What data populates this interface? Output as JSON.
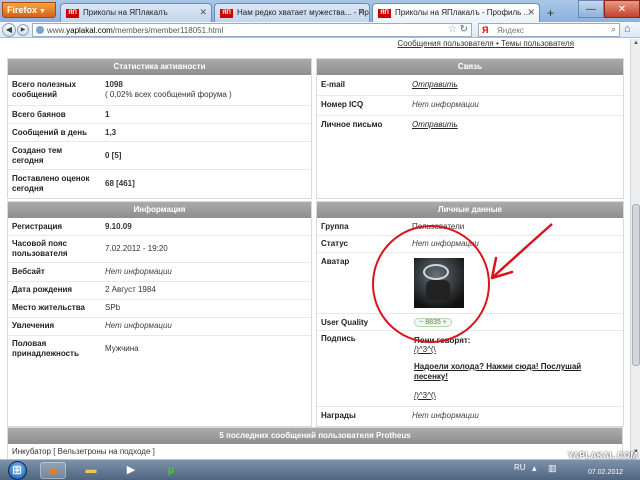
{
  "browser": {
    "menu_label": "Firefox",
    "tabs": [
      {
        "label": "Приколы на ЯПлакалъ",
        "active": false
      },
      {
        "label": "Нам редко хватает мужества... - Пр...",
        "active": false
      },
      {
        "label": "Приколы на ЯПлакалъ - Профиль ...",
        "active": true
      }
    ],
    "url_prefix": "www.",
    "url_domain": "yaplakal.com",
    "url_path": "/members/member118051.html",
    "search_placeholder": "Яндекс",
    "icons": [
      "back-icon",
      "forward-icon",
      "star-icon",
      "reload-icon",
      "search-icon",
      "home-icon"
    ]
  },
  "page": {
    "top_links": "Сообщения пользователя • Темы пользователя",
    "activity": {
      "title": "Статистика активности",
      "rows": [
        {
          "label": "Всего полезных сообщений",
          "value": "1098",
          "sub": "( 0,02% всех сообщений форума )"
        },
        {
          "label": "Всего баянов",
          "value": "1"
        },
        {
          "label": "Сообщений в день",
          "value": "1,3"
        },
        {
          "label": "Создано тем сегодня",
          "value": "0 [5]"
        },
        {
          "label": "Поставлено оценок сегодня",
          "value": "68 [461]"
        }
      ]
    },
    "contact": {
      "title": "Связь",
      "rows": [
        {
          "label": "E-mail",
          "value": "Отправить"
        },
        {
          "label": "Номер ICQ",
          "value": "Нет информации"
        },
        {
          "label": "Личное письмо",
          "value": "Отправить"
        }
      ]
    },
    "info": {
      "title": "Информация",
      "rows": [
        {
          "label": "Регистрация",
          "value": "9.10.09"
        },
        {
          "label": "Часовой пояс пользователя",
          "value": "7.02.2012 - 19:20"
        },
        {
          "label": "Вебсайт",
          "value": "Нет информации"
        },
        {
          "label": "Дата рождения",
          "value": "2 Август 1984"
        },
        {
          "label": "Место жительства",
          "value": "SPb"
        },
        {
          "label": "Увлечения",
          "value": "Нет информации"
        },
        {
          "label": "Половая принадлежность",
          "value": "Мужчина"
        }
      ]
    },
    "personal": {
      "title": "Личные данные",
      "group_label": "Группа",
      "group_value": "Пользователи",
      "status_label": "Статус",
      "status_value": "Нет информации",
      "avatar_label": "Аватар",
      "quality_label": "User Quality",
      "quality_minus": "−",
      "quality_value": "8835",
      "quality_plus": "+",
      "signature_label": "Подпись",
      "signature_lines": [
        "Пони говорят:",
        "/)^3^(\\",
        "Надоели холода? Нажми сюда! Послушай",
        "песенку!",
        "/)^3^(\\"
      ],
      "awards_label": "Награды",
      "awards_value": "Нет информации"
    },
    "last_posts": {
      "title": "5 последних сообщений пользователя Protheus",
      "first_item": "Инкубатор [ Вельзетроны на подходе ]"
    }
  },
  "taskbar": {
    "lang": "RU",
    "watermark": "YAPLAKAL.COM",
    "date": "07.02.2012"
  },
  "colors": {
    "panel_header": "#9e9e9e",
    "annotation_red": "#d9141c",
    "firefox_orange": "#e8821f",
    "quality_green": "#4a8a3e"
  }
}
